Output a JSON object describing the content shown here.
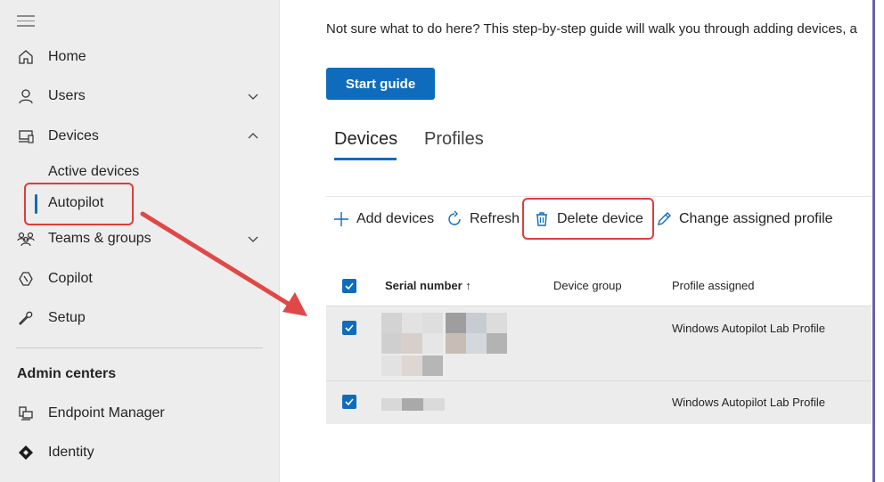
{
  "sidebar": {
    "items": [
      {
        "label": "Home",
        "icon": "home-icon"
      },
      {
        "label": "Users",
        "icon": "user-icon"
      },
      {
        "label": "Devices",
        "icon": "devices-icon"
      },
      {
        "label": "Teams & groups",
        "icon": "teams-icon"
      },
      {
        "label": "Copilot",
        "icon": "copilot-icon"
      },
      {
        "label": "Setup",
        "icon": "setup-icon"
      }
    ],
    "sub_items": [
      "Active devices",
      "Autopilot"
    ],
    "admin_title": "Admin centers",
    "admin_items": [
      {
        "label": "Endpoint Manager",
        "icon": "endpoint-manager-icon"
      },
      {
        "label": "Identity",
        "icon": "identity-icon"
      }
    ]
  },
  "main": {
    "guide_text": "Not sure what to do here? This step-by-step guide will walk you through adding devices, a",
    "start_button": "Start guide",
    "tabs": [
      "Devices",
      "Profiles"
    ],
    "commands": {
      "add": "Add devices",
      "refresh": "Refresh",
      "delete": "Delete device",
      "change": "Change assigned profile"
    },
    "table": {
      "columns": [
        "Serial number ↑",
        "Device group",
        "Profile assigned"
      ],
      "rows": [
        {
          "serial": "",
          "group": "",
          "profile": "Windows Autopilot Lab Profile"
        },
        {
          "serial": "",
          "group": "",
          "profile": "Windows Autopilot Lab Profile"
        }
      ]
    }
  },
  "colors": {
    "accent": "#0f6cbd",
    "highlight": "#e03c3c",
    "sidebar_bg": "#ededed"
  }
}
